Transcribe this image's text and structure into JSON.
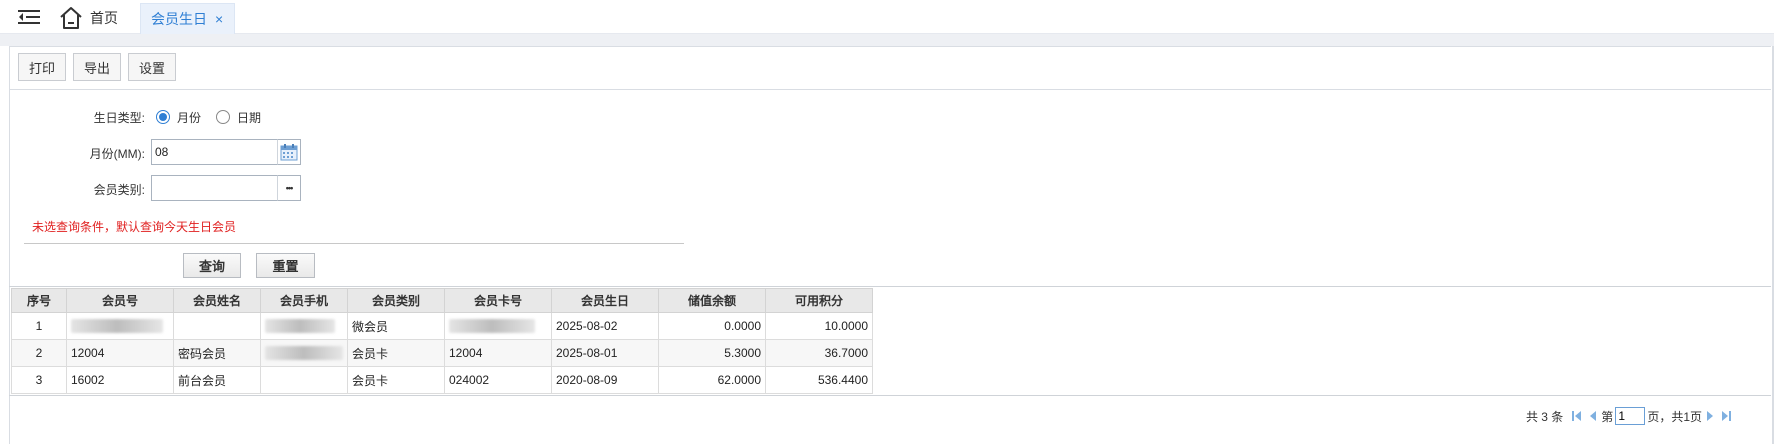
{
  "tabs": {
    "home_label": "首页",
    "active_label": "会员生日",
    "close_glyph": "×"
  },
  "toolbar": {
    "print_label": "打印",
    "export_label": "导出",
    "settings_label": "设置"
  },
  "form": {
    "birthday_type_label": "生日类型:",
    "radio_month_label": "月份",
    "radio_date_label": "日期",
    "selected_type": "月份",
    "month_label": "月份(MM):",
    "month_value": "08",
    "member_category_label": "会员类别:",
    "member_category_value": "",
    "member_category_button": "•••",
    "hint": "未选查询条件，默认查询今天生日会员",
    "query_label": "查询",
    "reset_label": "重置"
  },
  "table": {
    "columns": [
      "序号",
      "会员号",
      "会员姓名",
      "会员手机",
      "会员类别",
      "会员卡号",
      "会员生日",
      "储值余额",
      "可用积分"
    ],
    "rows": [
      {
        "index": "1",
        "member_no": "",
        "name": "",
        "phone": "",
        "category": "微会员",
        "card_no": "",
        "birthday": "2025-08-02",
        "balance": "0.0000",
        "points": "10.0000"
      },
      {
        "index": "2",
        "member_no": "12004",
        "name": "密码会员",
        "phone": "",
        "category": "会员卡",
        "card_no": "12004",
        "birthday": "2025-08-01",
        "balance": "5.3000",
        "points": "36.7000"
      },
      {
        "index": "3",
        "member_no": "16002",
        "name": "前台会员",
        "phone": "",
        "category": "会员卡",
        "card_no": "024002",
        "birthday": "2020-08-09",
        "balance": "62.0000",
        "points": "536.4400"
      }
    ]
  },
  "pager": {
    "total_text": "共 3 条",
    "page_prefix": "第",
    "current_page": "1",
    "page_suffix": "页，共1页"
  },
  "colors": {
    "accent": "#2f7fd4",
    "hint": "#e02020",
    "header_bg": "#e8e8e8"
  }
}
